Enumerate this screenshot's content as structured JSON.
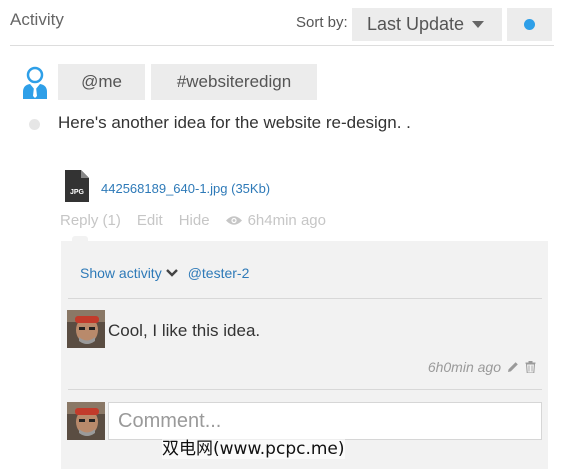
{
  "header": {
    "title": "Activity",
    "sort_label": "Sort by:",
    "sort_value": "Last Update",
    "status_color": "#2e9fe8"
  },
  "post": {
    "tags": [
      "@me",
      "#websiteredign"
    ],
    "text": "Here's another idea for the website re-design. .",
    "attachment": {
      "icon": "jpg-file-icon",
      "icon_label": "JPG",
      "link_text": "442568189_640-1.jpg (35Kb)"
    },
    "actions": {
      "reply": "Reply (1)",
      "edit": "Edit",
      "hide": "Hide",
      "time": "6h4min ago"
    }
  },
  "comments_panel": {
    "show_activity": "Show activity",
    "mention": "@tester-2",
    "comment": {
      "text": "Cool, I like this idea.",
      "time": "6h0min ago"
    },
    "input_placeholder": "Comment..."
  },
  "watermark": "双电网(www.pcpc.me)",
  "colors": {
    "link": "#2e7ab8",
    "user_icon": "#2e9fe8",
    "panel_bg": "#f2f2f2"
  }
}
